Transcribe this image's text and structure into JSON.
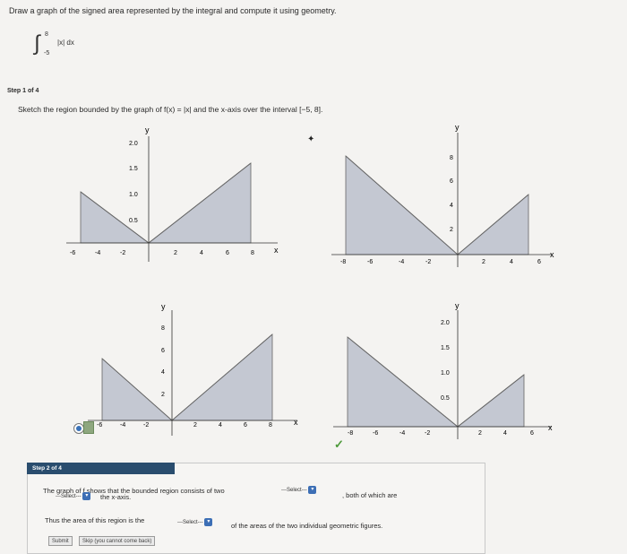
{
  "question": {
    "title": "Draw a graph of the signed area represented by the integral and compute it using geometry.",
    "integral_lower": "-5",
    "integral_upper": "8",
    "integrand": "|x| dx"
  },
  "step1": {
    "heading": "Step 1 of 4",
    "instruction_prefix": "Sketch the region bounded by the graph of f(x) = |x| and the x-axis over the interval [−5, 8]."
  },
  "graphs": {
    "axis_x": "x",
    "axis_y": "y",
    "a": {
      "xticks": [
        "-6",
        "-4",
        "-2",
        "2",
        "4",
        "6",
        "8"
      ],
      "yticks": [
        "2.0",
        "1.5",
        "1.0",
        "0.5"
      ]
    },
    "b": {
      "xticks": [
        "-8",
        "-6",
        "-4",
        "-2",
        "2",
        "4",
        "6"
      ],
      "yticks": [
        "8",
        "6",
        "4",
        "2"
      ]
    },
    "c": {
      "xticks": [
        "-6",
        "-4",
        "-2",
        "2",
        "4",
        "6",
        "8"
      ],
      "yticks": [
        "8",
        "6",
        "4",
        "2"
      ]
    },
    "d": {
      "xticks": [
        "-8",
        "-6",
        "-4",
        "-2",
        "2",
        "4",
        "6"
      ],
      "yticks": [
        "2.0",
        "1.5",
        "1.0",
        "0.5"
      ]
    }
  },
  "step2": {
    "heading": "Step 2 of 4",
    "line1": "The graph of f shows that the bounded region consists of two",
    "select1": "---Select---",
    "line1_end": ", both of which are",
    "select2": "---Select---",
    "line2_end": "the x-axis.",
    "line3": "Thus the area of this region is the",
    "select3": "---Select---",
    "line3_end": "of the areas of the two individual geometric figures.",
    "submit_label": "Submit",
    "skip_label": "Skip (you cannot come back)"
  },
  "colors": {
    "fill": "#c4c8d2",
    "header": "#2a4d6e",
    "accent": "#3d6fb5"
  }
}
